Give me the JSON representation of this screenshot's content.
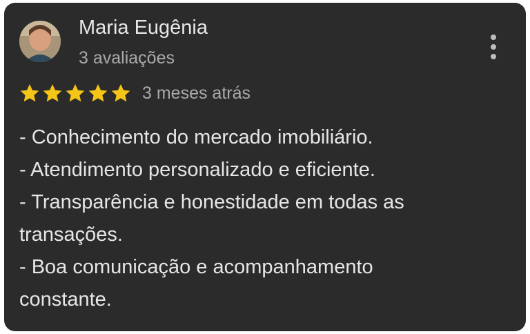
{
  "review": {
    "author_name": "Maria Eugênia",
    "reviews_count": "3 avaliações",
    "rating": 5,
    "rating_max": 5,
    "time_ago": "3 meses atrás",
    "text_lines": [
      "- Conhecimento do mercado imobiliário.",
      "- Atendimento personalizado e eficiente.",
      "- Transparência e honestidade em todas as",
      "transações.",
      "- Boa comunicação e acompanhamento",
      "constante."
    ]
  },
  "icons": {
    "star": "star-icon",
    "menu": "more-vert-icon"
  },
  "colors": {
    "card_background": "#2b2b2b",
    "star": "#f5c518",
    "primary_text": "#e8e8e8",
    "secondary_text": "#a9a9a9"
  }
}
